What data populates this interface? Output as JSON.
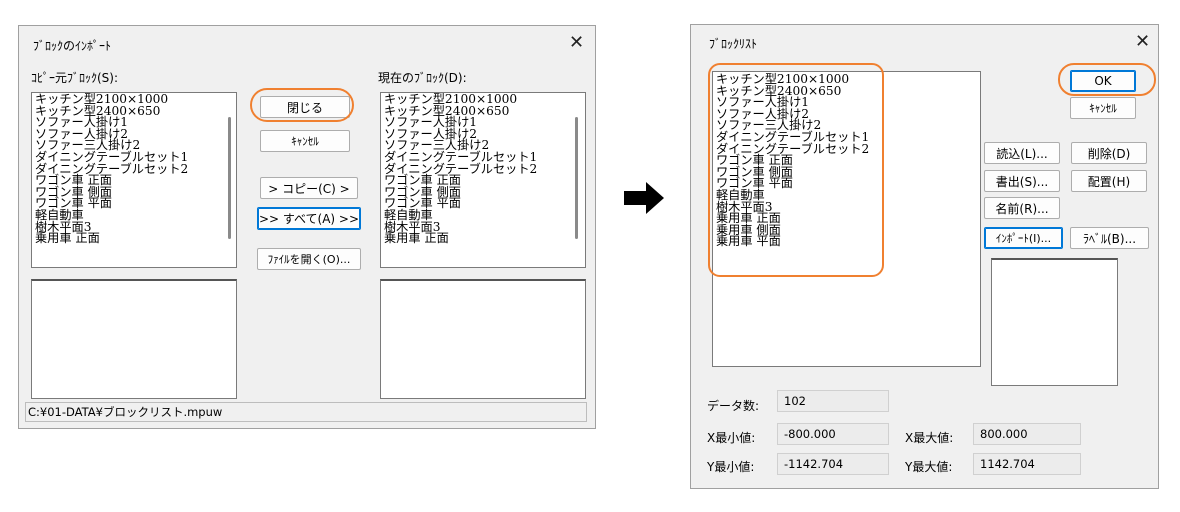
{
  "import_dialog": {
    "title": "ﾌﾞﾛｯｸのｲﾝﾎﾟｰﾄ",
    "close": "✕",
    "copy_source_label": "ｺﾋﾟｰ元ﾌﾞﾛｯｸ(S):",
    "current_label": "現在のﾌﾞﾛｯｸ(D):",
    "source_items": [
      "キッチン型2100×1000",
      "キッチン型2400×650",
      "ソファー人掛け1",
      "ソファー人掛け2",
      "ソファー三人掛け2",
      "ダイニングテーブルセット1",
      "ダイニングテーブルセット2",
      "ワゴン車 正面",
      "ワゴン車 側面",
      "ワゴン車 平面",
      "軽自動車",
      "樹木平面3",
      "乗用車 正面"
    ],
    "current_items": [
      "キッチン型2100×1000",
      "キッチン型2400×650",
      "ソファー人掛け1",
      "ソファー人掛け2",
      "ソファー三人掛け2",
      "ダイニングテーブルセット1",
      "ダイニングテーブルセット2",
      "ワゴン車 正面",
      "ワゴン車 側面",
      "ワゴン車 平面",
      "軽自動車",
      "樹木平面3",
      "乗用車 正面"
    ],
    "buttons": {
      "close": "閉じる",
      "cancel": "ｷｬﾝｾﾙ",
      "copy": "> コピー(C) >",
      "all": ">> すべて(A) >>",
      "open_file": "ﾌｧｲﾙを開く(O)..."
    },
    "status": "C:¥01-DATA¥ブロックリスト.mpuw"
  },
  "block_list_dialog": {
    "title": "ﾌﾞﾛｯｸﾘｽﾄ",
    "close": "✕",
    "items": [
      "キッチン型2100×1000",
      "キッチン型2400×650",
      "ソファー人掛け1",
      "ソファー人掛け2",
      "ソファー三人掛け2",
      "ダイニングテーブルセット1",
      "ダイニングテーブルセット2",
      "ワゴン車 正面",
      "ワゴン車 側面",
      "ワゴン車 平面",
      "軽自動車",
      "樹木平面3",
      "乗用車 正面",
      "乗用車 側面",
      "乗用車 平面"
    ],
    "buttons": {
      "ok": "OK",
      "cancel": "ｷｬﾝｾﾙ",
      "load": "読込(L)...",
      "delete": "削除(D)",
      "export": "書出(S)...",
      "place": "配置(H)",
      "rename": "名前(R)...",
      "import": "ｲﾝﾎﾟｰﾄ(I)...",
      "label": "ﾗﾍﾞﾙ(B)..."
    },
    "data_count_label": "データ数:",
    "data_count": "102",
    "x_min_label": "X最小値:",
    "x_min": "-800.000",
    "x_max_label": "X最大値:",
    "x_max": "800.000",
    "y_min_label": "Y最小値:",
    "y_min": "-1142.704",
    "y_max_label": "Y最大値:",
    "y_max": "1142.704"
  },
  "arrow_icon": "right-arrow-icon",
  "highlight_color": "#f08030"
}
